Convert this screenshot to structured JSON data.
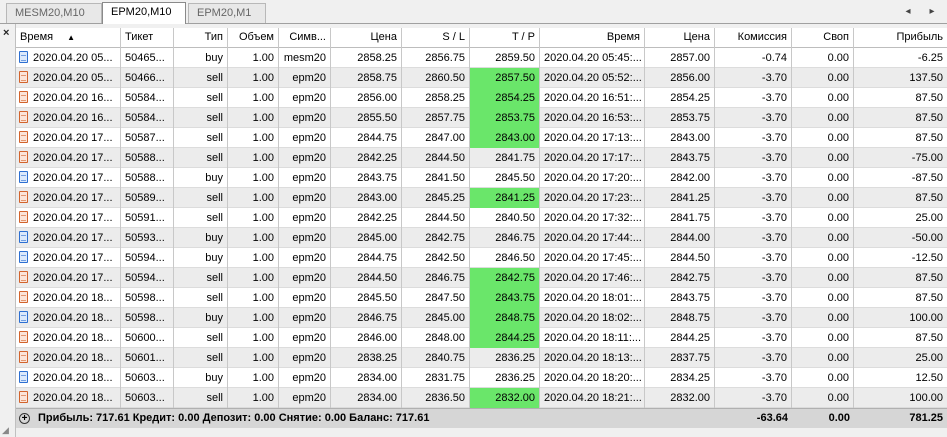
{
  "tabs": [
    {
      "label": "MESM20,M10",
      "active": false
    },
    {
      "label": "EPM20,M10",
      "active": true
    },
    {
      "label": "EPM20,M1",
      "active": false
    }
  ],
  "nav": {
    "left": "◂",
    "right": "▸"
  },
  "close_glyph": "×",
  "columns": {
    "time": "Время",
    "sort_arrow": "▲",
    "ticket": "Тикет",
    "type": "Тип",
    "volume": "Объем",
    "symbol": "Симв...",
    "price": "Цена",
    "sl": "S / L",
    "tp": "T / P",
    "close_time": "Время",
    "close_price": "Цена",
    "commission": "Комиссия",
    "swap": "Своп",
    "profit": "Прибыль"
  },
  "rows": [
    {
      "time": "2020.04.20 05...",
      "ticket": "50465...",
      "type": "buy",
      "volume": "1.00",
      "symbol": "mesm20",
      "price": "2858.25",
      "sl": "2856.75",
      "tp": "2859.50",
      "tp_hit": false,
      "close_time": "2020.04.20 05:45:...",
      "close_price": "2857.00",
      "commission": "-0.74",
      "swap": "0.00",
      "profit": "-6.25"
    },
    {
      "time": "2020.04.20 05...",
      "ticket": "50466...",
      "type": "sell",
      "volume": "1.00",
      "symbol": "epm20",
      "price": "2858.75",
      "sl": "2860.50",
      "tp": "2857.50",
      "tp_hit": true,
      "close_time": "2020.04.20 05:52:...",
      "close_price": "2856.00",
      "commission": "-3.70",
      "swap": "0.00",
      "profit": "137.50"
    },
    {
      "time": "2020.04.20 16...",
      "ticket": "50584...",
      "type": "sell",
      "volume": "1.00",
      "symbol": "epm20",
      "price": "2856.00",
      "sl": "2858.25",
      "tp": "2854.25",
      "tp_hit": true,
      "close_time": "2020.04.20 16:51:...",
      "close_price": "2854.25",
      "commission": "-3.70",
      "swap": "0.00",
      "profit": "87.50"
    },
    {
      "time": "2020.04.20 16...",
      "ticket": "50584...",
      "type": "sell",
      "volume": "1.00",
      "symbol": "epm20",
      "price": "2855.50",
      "sl": "2857.75",
      "tp": "2853.75",
      "tp_hit": true,
      "close_time": "2020.04.20 16:53:...",
      "close_price": "2853.75",
      "commission": "-3.70",
      "swap": "0.00",
      "profit": "87.50"
    },
    {
      "time": "2020.04.20 17...",
      "ticket": "50587...",
      "type": "sell",
      "volume": "1.00",
      "symbol": "epm20",
      "price": "2844.75",
      "sl": "2847.00",
      "tp": "2843.00",
      "tp_hit": true,
      "close_time": "2020.04.20 17:13:...",
      "close_price": "2843.00",
      "commission": "-3.70",
      "swap": "0.00",
      "profit": "87.50"
    },
    {
      "time": "2020.04.20 17...",
      "ticket": "50588...",
      "type": "sell",
      "volume": "1.00",
      "symbol": "epm20",
      "price": "2842.25",
      "sl": "2844.50",
      "tp": "2841.75",
      "tp_hit": false,
      "close_time": "2020.04.20 17:17:...",
      "close_price": "2843.75",
      "commission": "-3.70",
      "swap": "0.00",
      "profit": "-75.00"
    },
    {
      "time": "2020.04.20 17...",
      "ticket": "50588...",
      "type": "buy",
      "volume": "1.00",
      "symbol": "epm20",
      "price": "2843.75",
      "sl": "2841.50",
      "tp": "2845.50",
      "tp_hit": false,
      "close_time": "2020.04.20 17:20:...",
      "close_price": "2842.00",
      "commission": "-3.70",
      "swap": "0.00",
      "profit": "-87.50"
    },
    {
      "time": "2020.04.20 17...",
      "ticket": "50589...",
      "type": "sell",
      "volume": "1.00",
      "symbol": "epm20",
      "price": "2843.00",
      "sl": "2845.25",
      "tp": "2841.25",
      "tp_hit": true,
      "close_time": "2020.04.20 17:23:...",
      "close_price": "2841.25",
      "commission": "-3.70",
      "swap": "0.00",
      "profit": "87.50"
    },
    {
      "time": "2020.04.20 17...",
      "ticket": "50591...",
      "type": "sell",
      "volume": "1.00",
      "symbol": "epm20",
      "price": "2842.25",
      "sl": "2844.50",
      "tp": "2840.50",
      "tp_hit": false,
      "close_time": "2020.04.20 17:32:...",
      "close_price": "2841.75",
      "commission": "-3.70",
      "swap": "0.00",
      "profit": "25.00"
    },
    {
      "time": "2020.04.20 17...",
      "ticket": "50593...",
      "type": "buy",
      "volume": "1.00",
      "symbol": "epm20",
      "price": "2845.00",
      "sl": "2842.75",
      "tp": "2846.75",
      "tp_hit": false,
      "close_time": "2020.04.20 17:44:...",
      "close_price": "2844.00",
      "commission": "-3.70",
      "swap": "0.00",
      "profit": "-50.00"
    },
    {
      "time": "2020.04.20 17...",
      "ticket": "50594...",
      "type": "buy",
      "volume": "1.00",
      "symbol": "epm20",
      "price": "2844.75",
      "sl": "2842.50",
      "tp": "2846.50",
      "tp_hit": false,
      "close_time": "2020.04.20 17:45:...",
      "close_price": "2844.50",
      "commission": "-3.70",
      "swap": "0.00",
      "profit": "-12.50"
    },
    {
      "time": "2020.04.20 17...",
      "ticket": "50594...",
      "type": "sell",
      "volume": "1.00",
      "symbol": "epm20",
      "price": "2844.50",
      "sl": "2846.75",
      "tp": "2842.75",
      "tp_hit": true,
      "close_time": "2020.04.20 17:46:...",
      "close_price": "2842.75",
      "commission": "-3.70",
      "swap": "0.00",
      "profit": "87.50"
    },
    {
      "time": "2020.04.20 18...",
      "ticket": "50598...",
      "type": "sell",
      "volume": "1.00",
      "symbol": "epm20",
      "price": "2845.50",
      "sl": "2847.50",
      "tp": "2843.75",
      "tp_hit": true,
      "close_time": "2020.04.20 18:01:...",
      "close_price": "2843.75",
      "commission": "-3.70",
      "swap": "0.00",
      "profit": "87.50"
    },
    {
      "time": "2020.04.20 18...",
      "ticket": "50598...",
      "type": "buy",
      "volume": "1.00",
      "symbol": "epm20",
      "price": "2846.75",
      "sl": "2845.00",
      "tp": "2848.75",
      "tp_hit": true,
      "close_time": "2020.04.20 18:02:...",
      "close_price": "2848.75",
      "commission": "-3.70",
      "swap": "0.00",
      "profit": "100.00"
    },
    {
      "time": "2020.04.20 18...",
      "ticket": "50600...",
      "type": "sell",
      "volume": "1.00",
      "symbol": "epm20",
      "price": "2846.00",
      "sl": "2848.00",
      "tp": "2844.25",
      "tp_hit": true,
      "close_time": "2020.04.20 18:11:...",
      "close_price": "2844.25",
      "commission": "-3.70",
      "swap": "0.00",
      "profit": "87.50"
    },
    {
      "time": "2020.04.20 18...",
      "ticket": "50601...",
      "type": "sell",
      "volume": "1.00",
      "symbol": "epm20",
      "price": "2838.25",
      "sl": "2840.75",
      "tp": "2836.25",
      "tp_hit": false,
      "close_time": "2020.04.20 18:13:...",
      "close_price": "2837.75",
      "commission": "-3.70",
      "swap": "0.00",
      "profit": "25.00"
    },
    {
      "time": "2020.04.20 18...",
      "ticket": "50603...",
      "type": "buy",
      "volume": "1.00",
      "symbol": "epm20",
      "price": "2834.00",
      "sl": "2831.75",
      "tp": "2836.25",
      "tp_hit": false,
      "close_time": "2020.04.20 18:20:...",
      "close_price": "2834.25",
      "commission": "-3.70",
      "swap": "0.00",
      "profit": "12.50"
    },
    {
      "time": "2020.04.20 18...",
      "ticket": "50603...",
      "type": "sell",
      "volume": "1.00",
      "symbol": "epm20",
      "price": "2834.00",
      "sl": "2836.50",
      "tp": "2832.00",
      "tp_hit": true,
      "close_time": "2020.04.20 18:21:...",
      "close_price": "2832.00",
      "commission": "-3.70",
      "swap": "0.00",
      "profit": "100.00"
    }
  ],
  "footer": {
    "summary": "Прибыль: 717.61  Кредит: 0.00  Депозит: 0.00  Снятие: 0.00  Баланс: 717.61",
    "commission_total": "-63.64",
    "swap_total": "0.00",
    "profit_total": "781.25"
  },
  "colors": {
    "tp_hit": "#6ae66a",
    "buy_icon": "#2d6fd1",
    "sell_icon": "#d2632c"
  },
  "icons": {
    "buy": "buy-order-icon",
    "sell": "sell-order-icon",
    "footer": "expand-plus-icon"
  }
}
